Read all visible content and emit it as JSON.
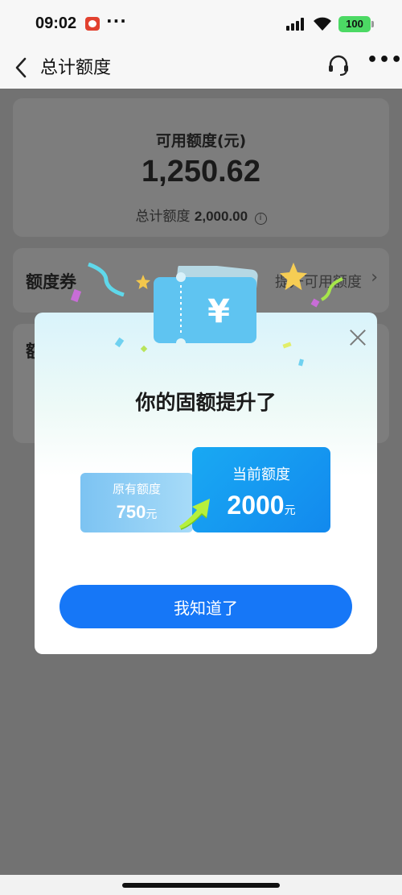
{
  "status_bar": {
    "time": "09:02",
    "more": "···",
    "battery": "100",
    "battery_color": "#4cd964"
  },
  "nav": {
    "title": "总计额度",
    "icons": [
      "back-icon",
      "headset-icon",
      "more-icon"
    ],
    "more": "•••"
  },
  "credit": {
    "title": "可用额度(元)",
    "amount": "1,250.62",
    "total_label": "总计额度",
    "total_value": "2,000.00"
  },
  "coupon": {
    "label": "额度券",
    "link": "提升可用额度"
  },
  "third_card": {
    "label": "额"
  },
  "modal": {
    "title": "你的固额提升了",
    "old_label": "原有额度",
    "old_value": "750",
    "old_unit": "元",
    "new_label": "当前额度",
    "new_value": "2000",
    "new_unit": "元",
    "button_label": "我知道了",
    "ticket_symbol": "¥",
    "button_color": "#1677f7",
    "accent_color": "#19a9f3"
  }
}
